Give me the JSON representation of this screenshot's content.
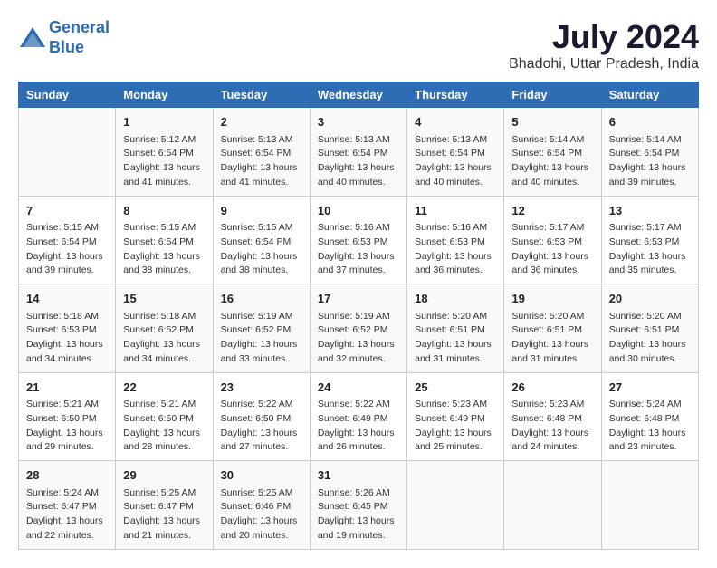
{
  "logo": {
    "line1": "General",
    "line2": "Blue"
  },
  "title": "July 2024",
  "subtitle": "Bhadohi, Uttar Pradesh, India",
  "days_header": [
    "Sunday",
    "Monday",
    "Tuesday",
    "Wednesday",
    "Thursday",
    "Friday",
    "Saturday"
  ],
  "weeks": [
    {
      "row_bg": "odd",
      "cells": [
        {
          "day": "",
          "content": ""
        },
        {
          "day": "1",
          "content": "Sunrise: 5:12 AM\nSunset: 6:54 PM\nDaylight: 13 hours\nand 41 minutes."
        },
        {
          "day": "2",
          "content": "Sunrise: 5:13 AM\nSunset: 6:54 PM\nDaylight: 13 hours\nand 41 minutes."
        },
        {
          "day": "3",
          "content": "Sunrise: 5:13 AM\nSunset: 6:54 PM\nDaylight: 13 hours\nand 40 minutes."
        },
        {
          "day": "4",
          "content": "Sunrise: 5:13 AM\nSunset: 6:54 PM\nDaylight: 13 hours\nand 40 minutes."
        },
        {
          "day": "5",
          "content": "Sunrise: 5:14 AM\nSunset: 6:54 PM\nDaylight: 13 hours\nand 40 minutes."
        },
        {
          "day": "6",
          "content": "Sunrise: 5:14 AM\nSunset: 6:54 PM\nDaylight: 13 hours\nand 39 minutes."
        }
      ]
    },
    {
      "row_bg": "even",
      "cells": [
        {
          "day": "7",
          "content": "Sunrise: 5:15 AM\nSunset: 6:54 PM\nDaylight: 13 hours\nand 39 minutes."
        },
        {
          "day": "8",
          "content": "Sunrise: 5:15 AM\nSunset: 6:54 PM\nDaylight: 13 hours\nand 38 minutes."
        },
        {
          "day": "9",
          "content": "Sunrise: 5:15 AM\nSunset: 6:54 PM\nDaylight: 13 hours\nand 38 minutes."
        },
        {
          "day": "10",
          "content": "Sunrise: 5:16 AM\nSunset: 6:53 PM\nDaylight: 13 hours\nand 37 minutes."
        },
        {
          "day": "11",
          "content": "Sunrise: 5:16 AM\nSunset: 6:53 PM\nDaylight: 13 hours\nand 36 minutes."
        },
        {
          "day": "12",
          "content": "Sunrise: 5:17 AM\nSunset: 6:53 PM\nDaylight: 13 hours\nand 36 minutes."
        },
        {
          "day": "13",
          "content": "Sunrise: 5:17 AM\nSunset: 6:53 PM\nDaylight: 13 hours\nand 35 minutes."
        }
      ]
    },
    {
      "row_bg": "odd",
      "cells": [
        {
          "day": "14",
          "content": "Sunrise: 5:18 AM\nSunset: 6:53 PM\nDaylight: 13 hours\nand 34 minutes."
        },
        {
          "day": "15",
          "content": "Sunrise: 5:18 AM\nSunset: 6:52 PM\nDaylight: 13 hours\nand 34 minutes."
        },
        {
          "day": "16",
          "content": "Sunrise: 5:19 AM\nSunset: 6:52 PM\nDaylight: 13 hours\nand 33 minutes."
        },
        {
          "day": "17",
          "content": "Sunrise: 5:19 AM\nSunset: 6:52 PM\nDaylight: 13 hours\nand 32 minutes."
        },
        {
          "day": "18",
          "content": "Sunrise: 5:20 AM\nSunset: 6:51 PM\nDaylight: 13 hours\nand 31 minutes."
        },
        {
          "day": "19",
          "content": "Sunrise: 5:20 AM\nSunset: 6:51 PM\nDaylight: 13 hours\nand 31 minutes."
        },
        {
          "day": "20",
          "content": "Sunrise: 5:20 AM\nSunset: 6:51 PM\nDaylight: 13 hours\nand 30 minutes."
        }
      ]
    },
    {
      "row_bg": "even",
      "cells": [
        {
          "day": "21",
          "content": "Sunrise: 5:21 AM\nSunset: 6:50 PM\nDaylight: 13 hours\nand 29 minutes."
        },
        {
          "day": "22",
          "content": "Sunrise: 5:21 AM\nSunset: 6:50 PM\nDaylight: 13 hours\nand 28 minutes."
        },
        {
          "day": "23",
          "content": "Sunrise: 5:22 AM\nSunset: 6:50 PM\nDaylight: 13 hours\nand 27 minutes."
        },
        {
          "day": "24",
          "content": "Sunrise: 5:22 AM\nSunset: 6:49 PM\nDaylight: 13 hours\nand 26 minutes."
        },
        {
          "day": "25",
          "content": "Sunrise: 5:23 AM\nSunset: 6:49 PM\nDaylight: 13 hours\nand 25 minutes."
        },
        {
          "day": "26",
          "content": "Sunrise: 5:23 AM\nSunset: 6:48 PM\nDaylight: 13 hours\nand 24 minutes."
        },
        {
          "day": "27",
          "content": "Sunrise: 5:24 AM\nSunset: 6:48 PM\nDaylight: 13 hours\nand 23 minutes."
        }
      ]
    },
    {
      "row_bg": "odd",
      "cells": [
        {
          "day": "28",
          "content": "Sunrise: 5:24 AM\nSunset: 6:47 PM\nDaylight: 13 hours\nand 22 minutes."
        },
        {
          "day": "29",
          "content": "Sunrise: 5:25 AM\nSunset: 6:47 PM\nDaylight: 13 hours\nand 21 minutes."
        },
        {
          "day": "30",
          "content": "Sunrise: 5:25 AM\nSunset: 6:46 PM\nDaylight: 13 hours\nand 20 minutes."
        },
        {
          "day": "31",
          "content": "Sunrise: 5:26 AM\nSunset: 6:45 PM\nDaylight: 13 hours\nand 19 minutes."
        },
        {
          "day": "",
          "content": ""
        },
        {
          "day": "",
          "content": ""
        },
        {
          "day": "",
          "content": ""
        }
      ]
    }
  ]
}
